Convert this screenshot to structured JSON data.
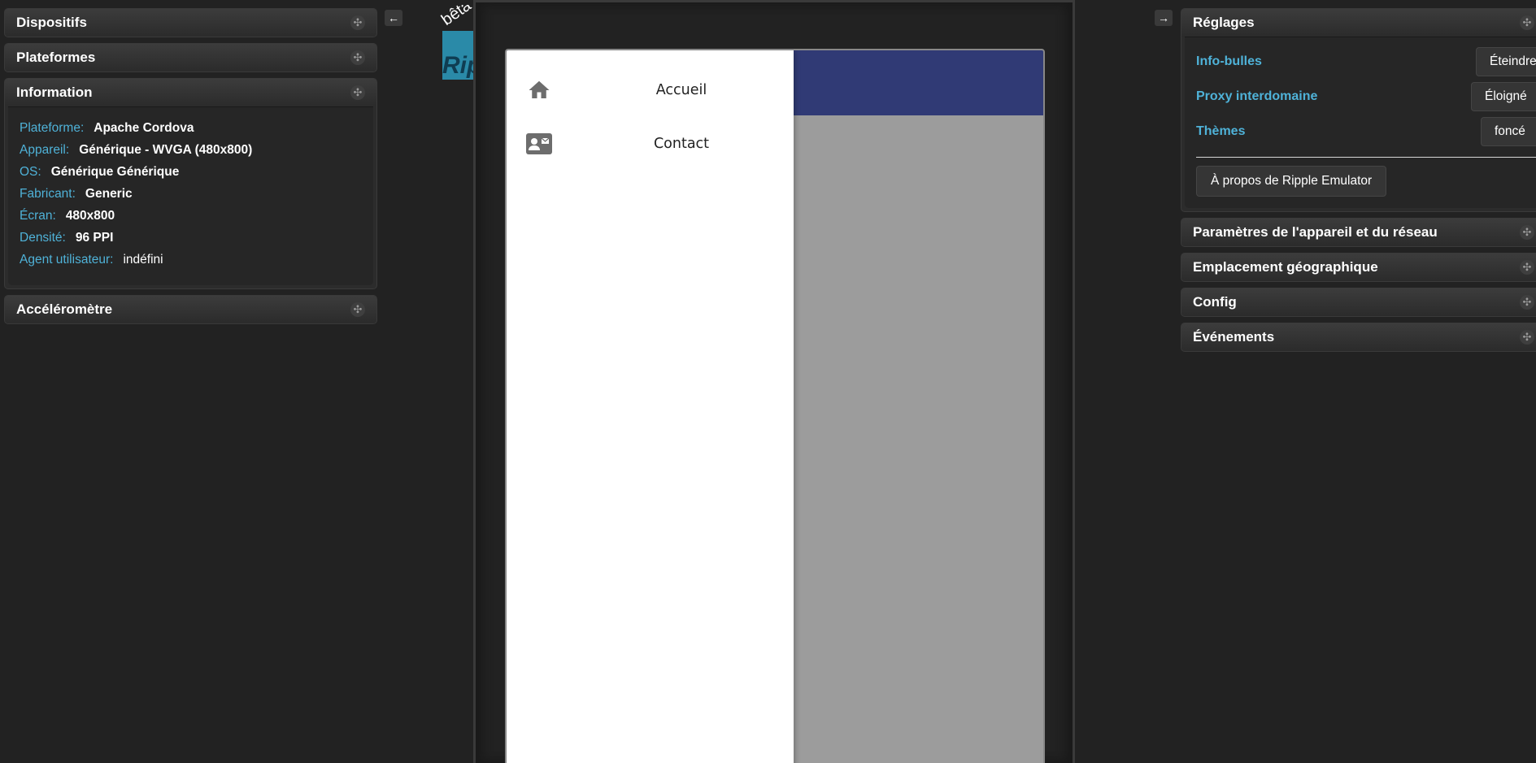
{
  "left_panels": {
    "devices": {
      "title": "Dispositifs"
    },
    "platforms": {
      "title": "Plateformes"
    },
    "information": {
      "title": "Information",
      "rows": [
        {
          "label": "Plateforme:",
          "value": "Apache Cordova"
        },
        {
          "label": "Appareil:",
          "value": "Générique - WVGA (480x800)"
        },
        {
          "label": "OS:",
          "value": "Générique Générique"
        },
        {
          "label": "Fabricant:",
          "value": "Generic"
        },
        {
          "label": "Écran:",
          "value": "480x800"
        },
        {
          "label": "Densité:",
          "value": "96 PPI"
        },
        {
          "label": "Agent utilisateur:",
          "value": "indéfini"
        }
      ]
    },
    "accelerometer": {
      "title": "Accéléromètre"
    }
  },
  "arrows": {
    "collapse_left": "←",
    "collapse_right": "→"
  },
  "logo": {
    "text": "Rip",
    "badge": "bêta"
  },
  "move_glyph": "✣",
  "app": {
    "drawer_items": [
      {
        "label": "Accueil",
        "icon": "home-icon"
      },
      {
        "label": "Contact",
        "icon": "contact-card-icon"
      }
    ],
    "colors": {
      "app_bar": "#303a75",
      "overlay": "#9c9c9c"
    }
  },
  "right_panels": {
    "settings": {
      "title": "Réglages",
      "rows": [
        {
          "label": "Info-bulles",
          "button": "Éteindre"
        },
        {
          "label": "Proxy interdomaine",
          "button": "Éloigné"
        },
        {
          "label": "Thèmes",
          "button": "foncé"
        }
      ],
      "about_button": "À propos de Ripple Emulator"
    },
    "device_network": {
      "title": "Paramètres de l'appareil et du réseau"
    },
    "geolocation": {
      "title": "Emplacement géographique"
    },
    "config": {
      "title": "Config"
    },
    "events": {
      "title": "Événements"
    }
  },
  "colors": {
    "accent": "#4fb2d8",
    "background": "#222222",
    "panel": "#2c2c2c"
  }
}
